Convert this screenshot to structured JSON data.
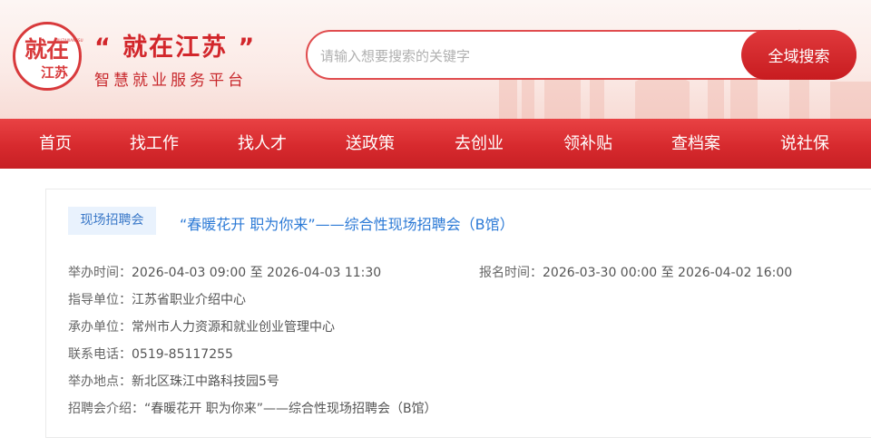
{
  "brand": {
    "logo_main": "就在",
    "logo_sub": "江苏",
    "logo_tiny": "JIUZAIJIANGSU",
    "title": "“ 就在江苏 ”",
    "subtitle": "智慧就业服务平台"
  },
  "search": {
    "placeholder": "请输入想要搜索的关键字",
    "button_label": "全域搜索"
  },
  "nav": {
    "items": [
      {
        "label": "首页"
      },
      {
        "label": "找工作"
      },
      {
        "label": "找人才"
      },
      {
        "label": "送政策"
      },
      {
        "label": "去创业"
      },
      {
        "label": "领补贴"
      },
      {
        "label": "查档案"
      },
      {
        "label": "说社保"
      }
    ]
  },
  "fair": {
    "tag": "现场招聘会",
    "title": "“春暖花开 职为你来”——综合性现场招聘会（B馆）",
    "hold_time_label": "举办时间：",
    "hold_time": "2026-04-03 09:00 至 2026-04-03 11:30",
    "signup_time_label": "报名时间：",
    "signup_time": "2026-03-30 00:00 至 2026-04-02 16:00",
    "guide_label": "指导单位：",
    "guide": "江苏省职业介绍中心",
    "organizer_label": "承办单位：",
    "organizer": "常州市人力资源和就业创业管理中心",
    "phone_label": "联系电话：",
    "phone": "0519-85117255",
    "place_label": "举办地点：",
    "place": "新北区珠江中路科技园5号",
    "intro_label": "招聘会介绍：",
    "intro": "“春暖花开 职为你来”——综合性现场招聘会（B馆）"
  },
  "colors": {
    "brand_red": "#d2262b",
    "nav_red": "#d72a2e",
    "link_blue": "#2c7ad6",
    "tag_bg": "#e9f2fd"
  }
}
